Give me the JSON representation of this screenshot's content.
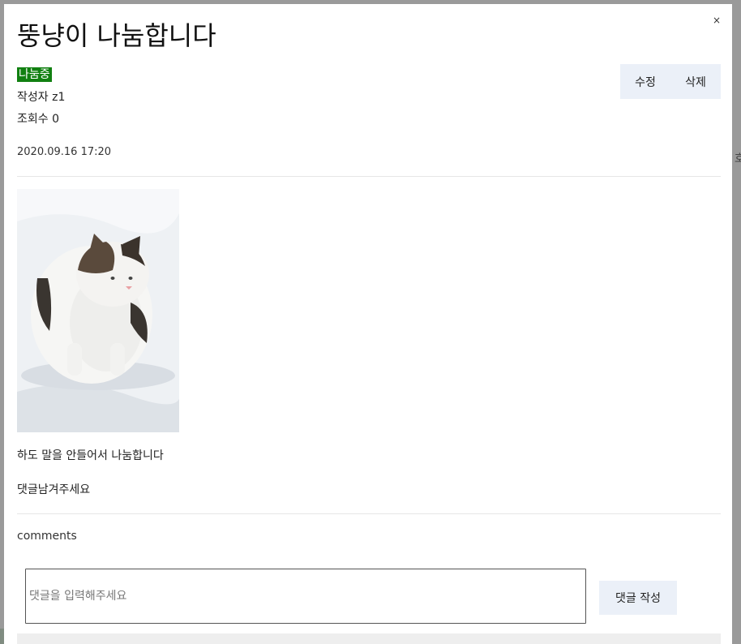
{
  "post": {
    "title": "뚱냥이 나눔합니다",
    "status": "나눔중",
    "author_label": "작성자 z1",
    "views_label": "조회수 0",
    "date": "2020.09.16 17:20",
    "body_line1": "하도 말을 안들어서 나눔합니다",
    "body_line2": "댓글남겨주세요",
    "image_alt": "cat-in-snow-photo"
  },
  "actions": {
    "edit_label": "수정",
    "delete_label": "삭제"
  },
  "modal": {
    "close_label": "×"
  },
  "comments": {
    "heading": "comments",
    "input_placeholder": "댓글을 입력해주세요",
    "input_value": "",
    "submit_label": "댓글 작성"
  },
  "background": {
    "right_text": "호"
  },
  "colors": {
    "status_badge": "#118011",
    "button_bg": "#ebf0f8",
    "overlay": "#8a8a8a"
  }
}
